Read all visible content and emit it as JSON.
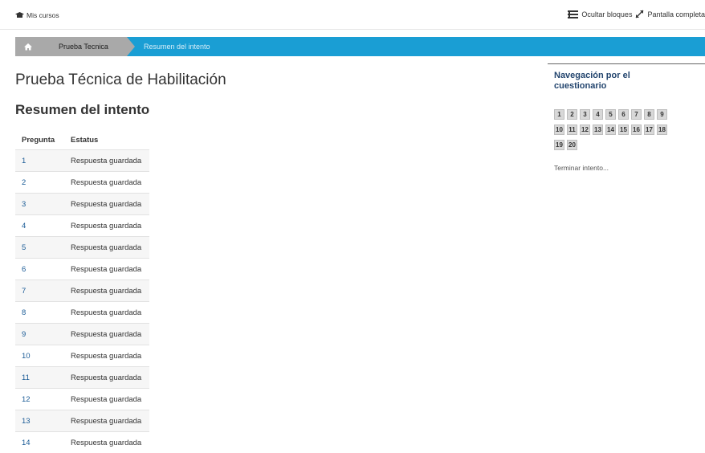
{
  "topbar": {
    "my_courses": "Mis cursos",
    "hide_blocks": "Ocultar bloques",
    "fullscreen": "Pantalla completa"
  },
  "breadcrumb": {
    "items": [
      "Prueba Tecnica",
      "Resumen del intento"
    ]
  },
  "main": {
    "title": "Prueba Técnica de Habilitación",
    "section_title": "Resumen del intento",
    "table": {
      "headers": [
        "Pregunta",
        "Estatus"
      ],
      "rows": [
        {
          "q": "1",
          "status": "Respuesta guardada"
        },
        {
          "q": "2",
          "status": "Respuesta guardada"
        },
        {
          "q": "3",
          "status": "Respuesta guardada"
        },
        {
          "q": "4",
          "status": "Respuesta guardada"
        },
        {
          "q": "5",
          "status": "Respuesta guardada"
        },
        {
          "q": "6",
          "status": "Respuesta guardada"
        },
        {
          "q": "7",
          "status": "Respuesta guardada"
        },
        {
          "q": "8",
          "status": "Respuesta guardada"
        },
        {
          "q": "9",
          "status": "Respuesta guardada"
        },
        {
          "q": "10",
          "status": "Respuesta guardada"
        },
        {
          "q": "11",
          "status": "Respuesta guardada"
        },
        {
          "q": "12",
          "status": "Respuesta guardada"
        },
        {
          "q": "13",
          "status": "Respuesta guardada"
        },
        {
          "q": "14",
          "status": "Respuesta guardada"
        }
      ]
    }
  },
  "quiz_nav": {
    "title": "Navegación por el cuestionario",
    "buttons": [
      "1",
      "2",
      "3",
      "4",
      "5",
      "6",
      "7",
      "8",
      "9",
      "10",
      "11",
      "12",
      "13",
      "14",
      "15",
      "16",
      "17",
      "18",
      "19",
      "20"
    ],
    "finish_link": "Terminar intento..."
  },
  "colors": {
    "breadcrumb_bg": "#1a9ed4",
    "crumb_inactive_bg": "#a9a9a9",
    "link": "#1a5b96",
    "block_title": "#23456e"
  }
}
